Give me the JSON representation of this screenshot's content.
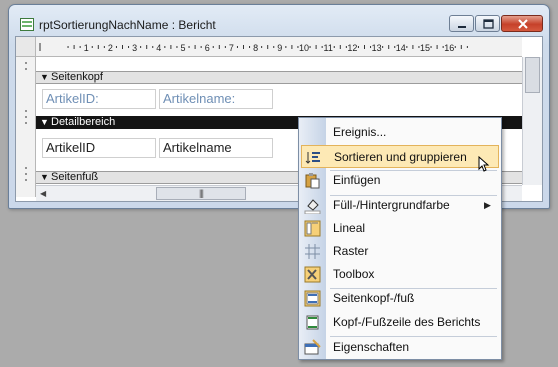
{
  "window": {
    "title": "rptSortierungNachName : Bericht"
  },
  "ruler": {
    "numbers": [
      "1",
      "2",
      "3",
      "4",
      "5",
      "6",
      "7",
      "8",
      "9",
      "10",
      "11",
      "12",
      "13",
      "14",
      "15",
      "16"
    ]
  },
  "sections": {
    "page_header": "Seitenkopf",
    "detail": "Detailbereich",
    "page_footer": "Seitenfuß"
  },
  "controls": {
    "label_id": "ArtikelID:",
    "label_name": "Artikelname:",
    "field_id": "ArtikelID",
    "field_name": "Artikelname"
  },
  "context_menu": {
    "items": [
      {
        "label": "Ereignis...",
        "icon": "none"
      },
      {
        "label": "Sortieren und gruppieren",
        "icon": "sort-group-icon",
        "highlighted": true
      },
      {
        "label": "Einfügen",
        "icon": "paste-icon"
      },
      {
        "label": "Füll-/Hintergrundfarbe",
        "icon": "fill-color-icon",
        "submenu": true
      },
      {
        "label": "Lineal",
        "icon": "ruler-icon"
      },
      {
        "label": "Raster",
        "icon": "grid-icon"
      },
      {
        "label": "Toolbox",
        "icon": "toolbox-icon"
      },
      {
        "label": "Seitenkopf-/fuß",
        "icon": "page-header-footer-icon"
      },
      {
        "label": "Kopf-/Fußzeile des Berichts",
        "icon": "report-header-footer-icon"
      },
      {
        "label": "Eigenschaften",
        "icon": "properties-icon"
      }
    ]
  },
  "colors": {
    "highlight": "#fde9b5",
    "label_text": "#6f8fb5",
    "detail_bar": "#141414"
  }
}
